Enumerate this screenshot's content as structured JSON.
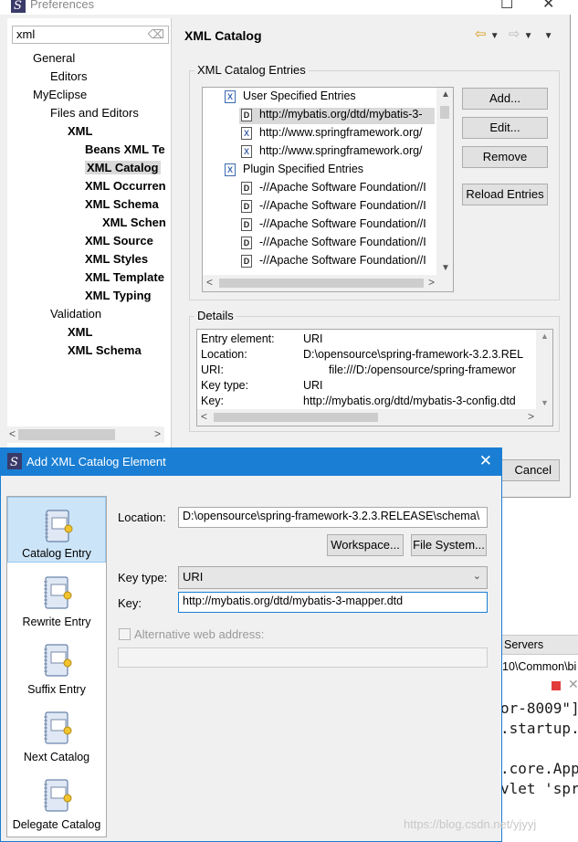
{
  "prefs": {
    "title": "Preferences",
    "filter_value": "xml",
    "tree": [
      {
        "label": "General",
        "bold": false,
        "selected": false
      },
      {
        "label": "Editors",
        "bold": false,
        "selected": false
      },
      {
        "label": "MyEclipse",
        "bold": false,
        "selected": false
      },
      {
        "label": "Files and Editors",
        "bold": false,
        "selected": false
      },
      {
        "label": "XML",
        "bold": true,
        "selected": false
      },
      {
        "label": "Beans XML Te",
        "bold": true,
        "selected": false
      },
      {
        "label": "XML Catalog",
        "bold": true,
        "selected": true
      },
      {
        "label": "XML Occurren",
        "bold": true,
        "selected": false
      },
      {
        "label": "XML Schema",
        "bold": true,
        "selected": false
      },
      {
        "label": "XML Schen",
        "bold": true,
        "selected": false
      },
      {
        "label": "XML Source",
        "bold": true,
        "selected": false
      },
      {
        "label": "XML Styles",
        "bold": true,
        "selected": false
      },
      {
        "label": "XML Template",
        "bold": true,
        "selected": false
      },
      {
        "label": "XML Typing",
        "bold": true,
        "selected": false
      },
      {
        "label": "Validation",
        "bold": false,
        "selected": false
      },
      {
        "label": "XML",
        "bold": true,
        "selected": false
      },
      {
        "label": "XML Schema",
        "bold": true,
        "selected": false
      }
    ],
    "page_title": "XML Catalog",
    "entries_group": "XML Catalog Entries",
    "entries": [
      {
        "type": "catalog",
        "label": "User Specified Entries"
      },
      {
        "type": "D",
        "label": "http://mybatis.org/dtd/mybatis-3-",
        "selected": true
      },
      {
        "type": "X",
        "label": "http://www.springframework.org/"
      },
      {
        "type": "X",
        "label": "http://www.springframework.org/"
      },
      {
        "type": "catalog",
        "label": "Plugin Specified Entries"
      },
      {
        "type": "D",
        "label": "-//Apache Software Foundation//I"
      },
      {
        "type": "D",
        "label": "-//Apache Software Foundation//I"
      },
      {
        "type": "D",
        "label": "-//Apache Software Foundation//I"
      },
      {
        "type": "D",
        "label": "-//Apache Software Foundation//I"
      },
      {
        "type": "D",
        "label": "-//Apache Software Foundation//I"
      }
    ],
    "buttons": {
      "add": "Add...",
      "edit": "Edit...",
      "remove": "Remove",
      "reload": "Reload Entries",
      "cancel": "Cancel"
    },
    "details_group": "Details",
    "details": [
      {
        "key": "Entry element:",
        "value": "URI"
      },
      {
        "key": "Location:",
        "value": "D:\\opensource\\spring-framework-3.2.3.REL"
      },
      {
        "key": "URI:",
        "value": "file:///D:/opensource/spring-framewor"
      },
      {
        "key": "Key type:",
        "value": "URI"
      },
      {
        "key": "Key:",
        "value": "http://mybatis.org/dtd/mybatis-3-config.dtd"
      }
    ]
  },
  "background_editor": {
    "tab": "Servers",
    "path": "10\\Common\\bi",
    "lines": [
      "or-8009\"]",
      ".startup.",
      ".core.App",
      "vlet 'spr"
    ]
  },
  "dialog": {
    "title": "Add XML Catalog Element",
    "sidebar": [
      {
        "label": "Catalog Entry",
        "icon": "catalog-entry-icon",
        "selected": true
      },
      {
        "label": "Rewrite Entry",
        "icon": "rewrite-entry-icon",
        "selected": false
      },
      {
        "label": "Suffix Entry",
        "icon": "suffix-entry-icon",
        "selected": false
      },
      {
        "label": "Next Catalog",
        "icon": "next-catalog-icon",
        "selected": false
      },
      {
        "label": "Delegate Catalog",
        "icon": "delegate-catalog-icon",
        "selected": false
      }
    ],
    "location_label": "Location:",
    "location_value": "D:\\opensource\\spring-framework-3.2.3.RELEASE\\schema\\",
    "workspace_button": "Workspace...",
    "filesystem_button": "File System...",
    "keytype_label": "Key type:",
    "keytype_value": "URI",
    "key_label": "Key:",
    "key_value": "http://mybatis.org/dtd/mybatis-3-mapper.dtd",
    "alt_label": "Alternative web address:",
    "alt_value": ""
  },
  "watermark": "https://blog.csdn.net/yjyyj",
  "colors": {
    "accent": "#1a7fd4",
    "selection": "#cce4f7",
    "tree_selection": "#d9d9d9"
  }
}
